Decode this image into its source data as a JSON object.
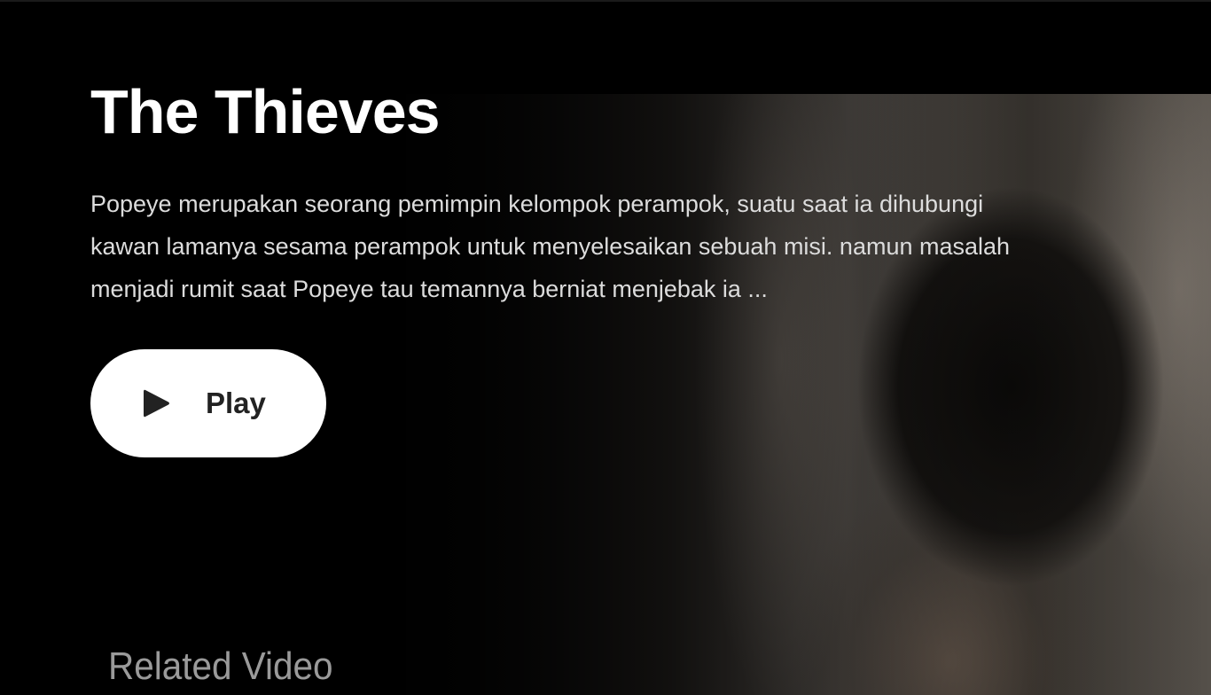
{
  "hero": {
    "title": "The Thieves",
    "description": "Popeye merupakan seorang pemimpin kelompok perampok, suatu saat ia dihubungi kawan lamanya sesama perampok untuk menyelesaikan sebuah misi. namun masalah menjadi rumit saat Popeye tau temannya berniat menjebak ia ...",
    "play_button": {
      "label": "Play",
      "icon": "play-icon"
    }
  },
  "related": {
    "heading": "Related Video"
  },
  "colors": {
    "background": "#000000",
    "title": "#ffffff",
    "description": "#dcdcdc",
    "button_bg": "#ffffff",
    "button_text": "#222222",
    "related_heading": "#9a9a9a"
  }
}
